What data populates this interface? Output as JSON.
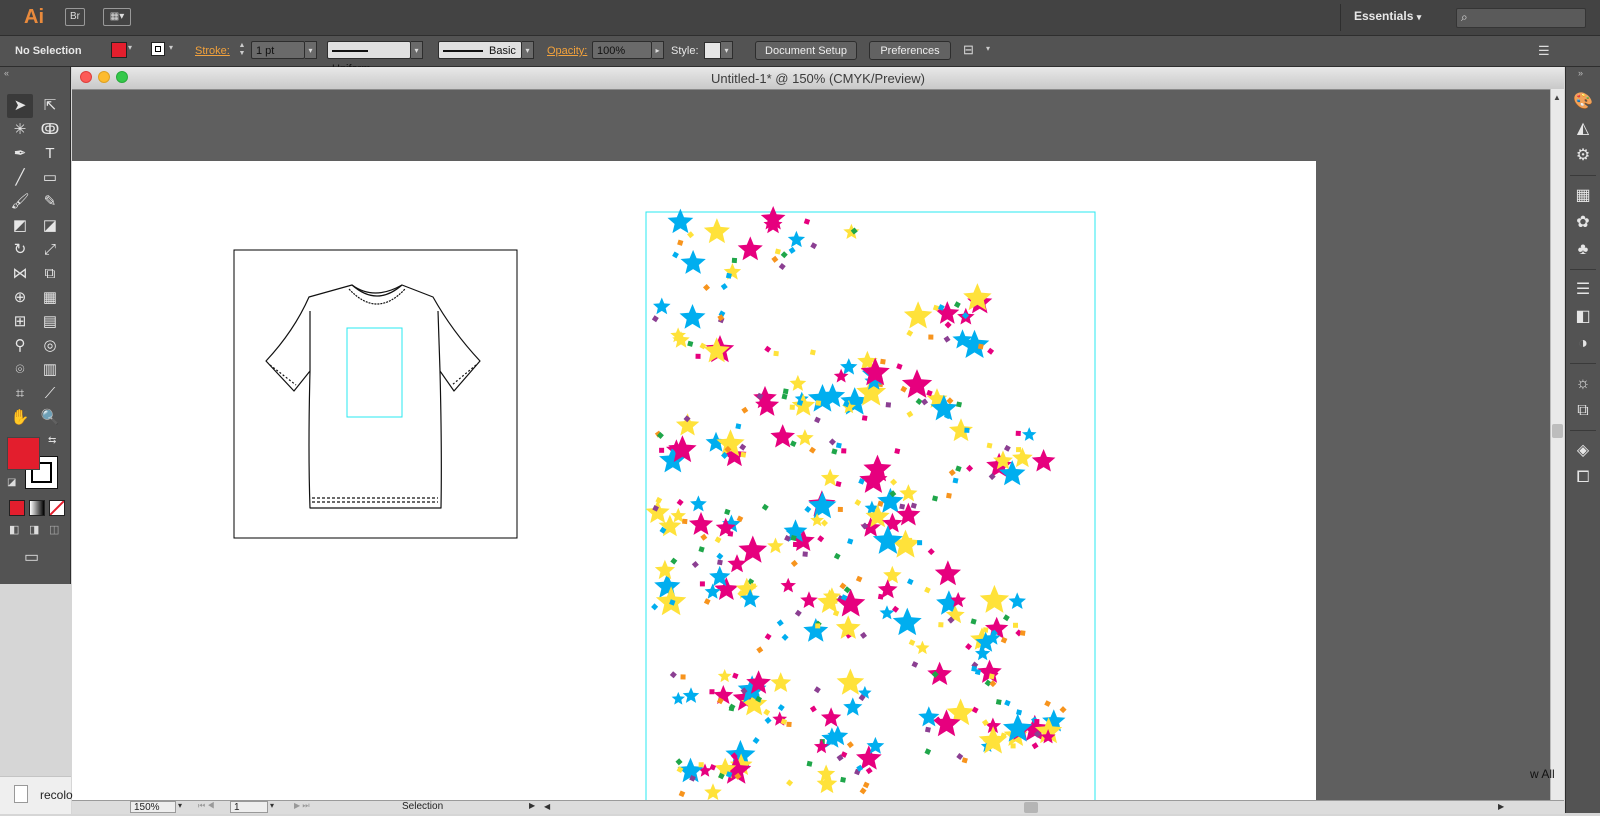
{
  "app": {
    "logo": "Ai",
    "bridge_button": "Br",
    "workspace": "Essentials",
    "workspace_arrow": "▾"
  },
  "control_bar": {
    "selection_status": "No Selection",
    "stroke_label": "Stroke:",
    "stroke_weight": "1 pt",
    "stroke_profile": "Uniform",
    "brush": "Basic",
    "opacity_label": "Opacity:",
    "opacity_value": "100%",
    "style_label": "Style:",
    "document_setup": "Document Setup",
    "preferences": "Preferences"
  },
  "document": {
    "title": "Untitled-1* @ 150% (CMYK/Preview)"
  },
  "status_bar": {
    "zoom": "150%",
    "artboard_number": "1",
    "tool_name": "Selection"
  },
  "taskbar": {
    "file_label": "recolo",
    "show_all": "w All"
  },
  "colors": {
    "fill": "#e31e2d",
    "stroke": "#000000",
    "magenta": "#e6007e",
    "cyan": "#00aeef",
    "yellow": "#ffe23a",
    "purple": "#8b3f92",
    "green": "#1fa64a",
    "orange": "#f7941d",
    "guide": "#28e8f0"
  }
}
